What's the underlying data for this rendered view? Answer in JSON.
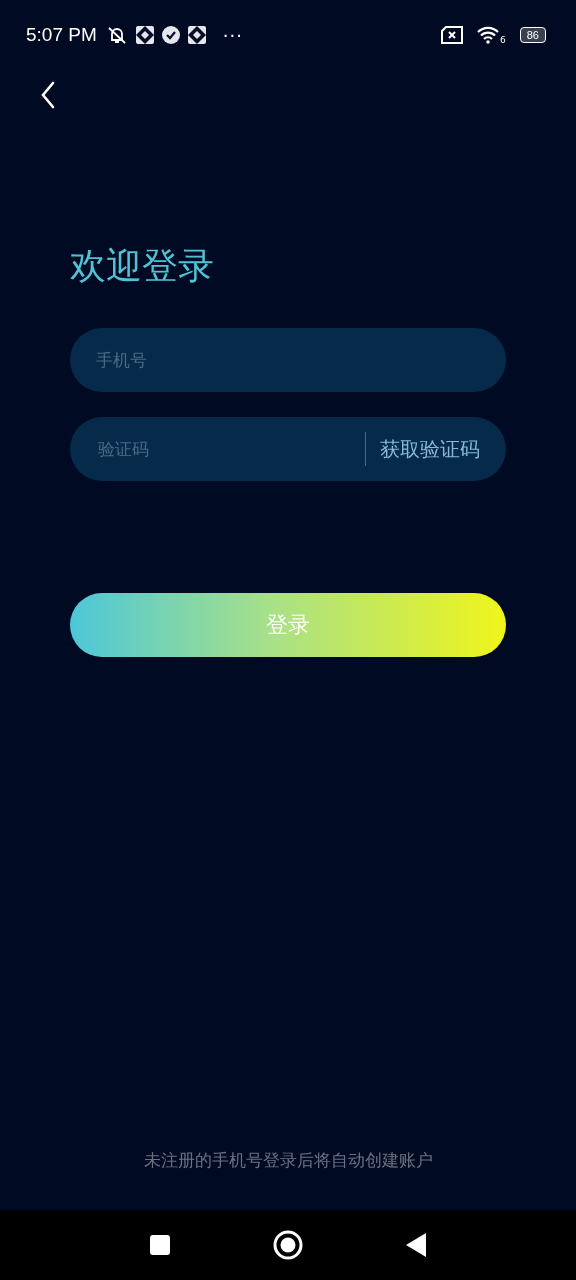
{
  "status_bar": {
    "time": "5:07 PM",
    "more": "···",
    "wifi_label": "6",
    "battery": "86"
  },
  "title": "欢迎登录",
  "phone_field": {
    "placeholder": "手机号"
  },
  "code_field": {
    "placeholder": "验证码",
    "action": "获取验证码"
  },
  "login_button": "登录",
  "footer_note": "未注册的手机号登录后将自动创建账户"
}
